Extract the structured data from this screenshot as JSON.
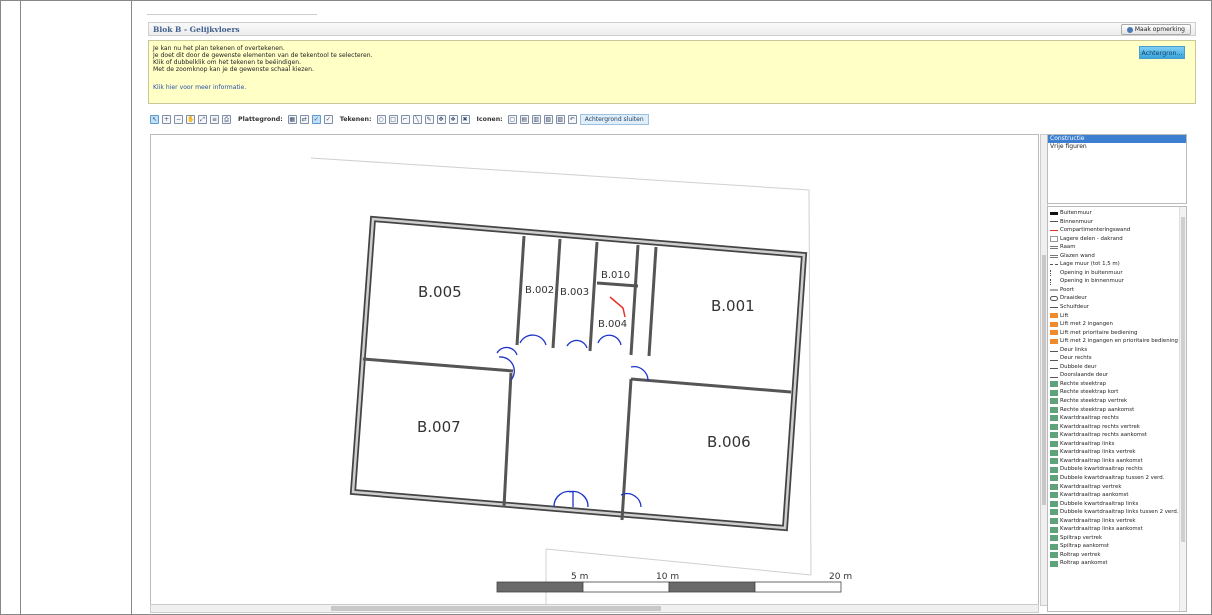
{
  "header": {
    "title": "Blok B - Gelijkvloers",
    "remark_button": "Maak opmerking"
  },
  "info": {
    "lines": [
      "Je kan nu het plan tekenen of overtekenen.",
      "Je doet dit door de gewenste elementen van de tekentool te selecteren.",
      "Klik of dubbelklik om het tekenen te beëindigen.",
      "Met de zoomknop kan je de gewenste schaal kiezen."
    ],
    "more_info_link": "Klik hier voor meer informatie.",
    "background_button": "Achtergron..."
  },
  "toolbar": {
    "plattegrond_label": "Plattegrond:",
    "tekenen_label": "Tekenen:",
    "iconen_label": "Iconen:",
    "close_background_button": "Achtergrond sluiten"
  },
  "plan": {
    "rooms": [
      "B.005",
      "B.002",
      "B.003",
      "B.010",
      "B.004",
      "B.001",
      "B.007",
      "B.006"
    ],
    "scale_labels": [
      "5 m",
      "10 m",
      "20 m"
    ]
  },
  "layers": {
    "items": [
      "Constructie",
      "Vrije figuren"
    ],
    "selected": "Constructie"
  },
  "legend": {
    "items": [
      "Buitenmuur",
      "Binnenmuur",
      "Compartimenteringswand",
      "Lagere delen - dakrand",
      "Raam",
      "Glazen wand",
      "Lage muur (tot 1,5 m)",
      "Opening in buitenmuur",
      "Opening in binnenmuur",
      "Poort",
      "Draaideur",
      "Schuifdeur",
      "Lift",
      "Lift met 2 ingangen",
      "Lift met prioritaire bediening",
      "Lift met 2 ingangen en prioritaire bediening",
      "Deur links",
      "Deur rechts",
      "Dubbele deur",
      "Doorslaande deur",
      "Rechte steektrap",
      "Rechte steektrap kort",
      "Rechte steektrap vertrek",
      "Rechte steektrap aankomst",
      "Kwartdraaitrap rechts",
      "Kwartdraaitrap rechts vertrek",
      "Kwartdraaitrap rechts aankomst",
      "Kwartdraaitrap links",
      "Kwartdraaitrap links vertrek",
      "Kwartdraaitrap links aankomst",
      "Dubbele kwartdraaitrap rechts",
      "Dubbele kwartdraaitrap tussen 2 verd.",
      "Kwartdraaitrap vertrek",
      "Kwartdraaitrap aankomst",
      "Dubbele kwartdraaitrap links",
      "Dubbele kwartdraaitrap links tussen 2 verd.",
      "Kwartdraaitrap links vertrek",
      "Kwartdraaitrap links aankomst",
      "Spiltrap vertrek",
      "Spiltrap aankomst",
      "Roltrap vertrek",
      "Roltrap aankomst"
    ]
  },
  "colors": {
    "info_bg": "#ffffc6",
    "accent": "#3c7fd0",
    "wall": "#333333",
    "door": "#1f35c9",
    "fire_wall": "#e8302a"
  }
}
